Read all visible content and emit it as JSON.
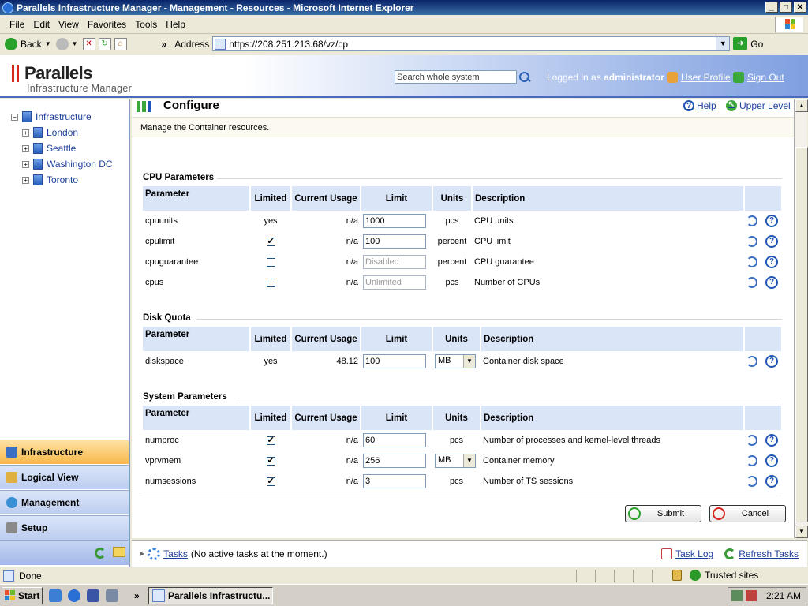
{
  "window": {
    "title": "Parallels Infrastructure Manager - Management - Resources - Microsoft Internet Explorer",
    "controls": [
      "_",
      "□",
      "✕"
    ]
  },
  "menu": [
    "File",
    "Edit",
    "View",
    "Favorites",
    "Tools",
    "Help"
  ],
  "toolbar": {
    "back_label": "Back",
    "address_label": "Address",
    "address_value": "https://208.251.213.68/vz/cp",
    "go_label": "Go",
    "more": "»"
  },
  "header": {
    "brand": "Parallels",
    "product": "Infrastructure Manager",
    "search_placeholder": "Search whole system",
    "logged_in_prefix": "Logged in as",
    "user": "administrator",
    "user_profile": "User Profile",
    "sign_out": "Sign Out"
  },
  "sidebar": {
    "tree_root": "Infrastructure",
    "tree_items": [
      "London",
      "Seattle",
      "Washington DC",
      "Toronto"
    ],
    "sections": [
      "Infrastructure",
      "Logical View",
      "Management",
      "Setup"
    ],
    "active_section": "Infrastructure"
  },
  "page": {
    "title": "Configure",
    "help": "Help",
    "upper_level": "Upper Level",
    "intro": "Manage the Container resources."
  },
  "columns": {
    "parameter": "Parameter",
    "limited": "Limited",
    "current_usage": "Current Usage",
    "limit": "Limit",
    "units": "Units",
    "description": "Description"
  },
  "cpu": {
    "title": "CPU Parameters",
    "rows": [
      {
        "parameter": "cpuunits",
        "limited": "yes",
        "usage": "n/a",
        "limit": "1000",
        "units": "pcs",
        "description": "CPU units"
      },
      {
        "parameter": "cpulimit",
        "limited": "checked",
        "usage": "n/a",
        "limit": "100",
        "units": "percent",
        "description": "CPU limit"
      },
      {
        "parameter": "cpuguarantee",
        "limited": "unchecked",
        "usage": "n/a",
        "limit": "Disabled",
        "units": "percent",
        "description": "CPU guarantee"
      },
      {
        "parameter": "cpus",
        "limited": "unchecked",
        "usage": "n/a",
        "limit": "Unlimited",
        "units": "pcs",
        "description": "Number of CPUs"
      }
    ]
  },
  "disk": {
    "title": "Disk Quota",
    "rows": [
      {
        "parameter": "diskspace",
        "limited": "yes",
        "usage": "48.12",
        "limit": "100",
        "units": "MB",
        "description": "Container disk space"
      }
    ]
  },
  "system": {
    "title": "System Parameters",
    "rows": [
      {
        "parameter": "numproc",
        "limited": "checked",
        "usage": "n/a",
        "limit": "60",
        "units": "pcs",
        "description": "Number of processes and kernel-level threads"
      },
      {
        "parameter": "vprvmem",
        "limited": "checked",
        "usage": "n/a",
        "limit": "256",
        "units": "MB",
        "description": "Container memory"
      },
      {
        "parameter": "numsessions",
        "limited": "checked",
        "usage": "n/a",
        "limit": "3",
        "units": "pcs",
        "description": "Number of TS sessions"
      }
    ]
  },
  "buttons": {
    "submit": "Submit",
    "cancel": "Cancel"
  },
  "tasks": {
    "label": "Tasks",
    "status": "(No active tasks at the moment.)",
    "task_log": "Task Log",
    "refresh": "Refresh Tasks"
  },
  "statusbar": {
    "status": "Done",
    "zone": "Trusted sites"
  },
  "taskbar": {
    "start": "Start",
    "window_item": "Parallels Infrastructu...",
    "more": "»",
    "clock": "2:21 AM"
  },
  "colors": {
    "title_bar": "#0a246a",
    "link": "#1d3f99",
    "table_header": "#dbe5f8",
    "brand_red": "#d8261f",
    "active_nav": "#f7b84a"
  }
}
